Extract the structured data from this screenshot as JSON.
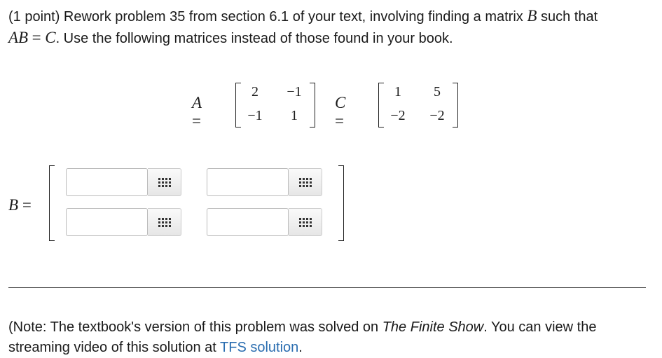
{
  "problem": {
    "prefix": "(1 point) Rework problem 35 from section 6.1 of your text, involving finding a matrix",
    "var_b": "B",
    "such_that": "such that",
    "var_ab": "AB",
    "equals": "=",
    "var_c": "C",
    "suffix": ". Use the following matrices instead of those found in your book."
  },
  "matrix_a": {
    "label": "A",
    "equals": "=",
    "rows": [
      [
        "2",
        "−1"
      ],
      [
        "−1",
        "1"
      ]
    ]
  },
  "matrix_c": {
    "label": "C",
    "equals": "=",
    "rows": [
      [
        "1",
        "5"
      ],
      [
        "−2",
        "−2"
      ]
    ]
  },
  "answer_matrix": {
    "label": "B",
    "equals": "=",
    "cells": [
      {
        "value": "",
        "palette_icon": "grid-icon"
      },
      {
        "value": "",
        "palette_icon": "grid-icon"
      },
      {
        "value": "",
        "palette_icon": "grid-icon"
      },
      {
        "value": "",
        "palette_icon": "grid-icon"
      }
    ]
  },
  "note": {
    "prefix": "(Note: The textbook's version of this problem was solved on",
    "show_name": "The Finite Show",
    "middle": ". You can view the streaming video of this solution at",
    "link_text": "TFS solution",
    "suffix": "."
  },
  "colors": {
    "link": "#2a6db0",
    "text": "#1a1a1a",
    "input_border": "#bbbbbb"
  }
}
